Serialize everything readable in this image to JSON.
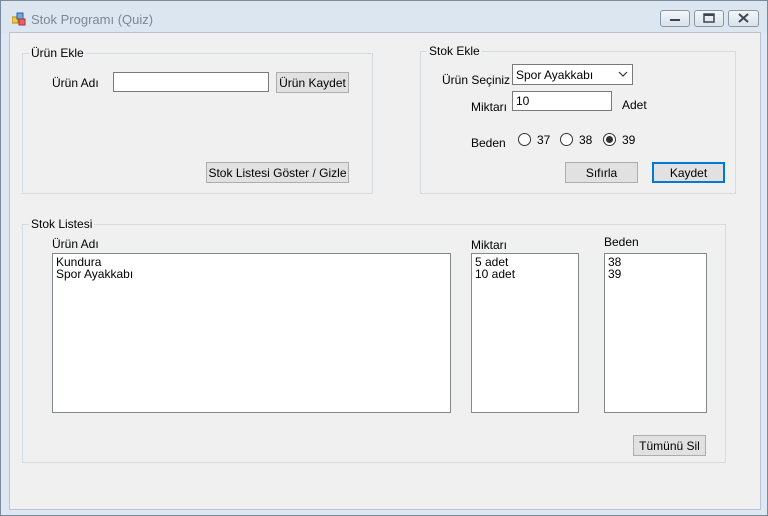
{
  "window": {
    "title": "Stok Programı (Quiz)"
  },
  "urun_ekle": {
    "group_label": "Ürün Ekle",
    "name_label": "Ürün Adı",
    "name_value": "",
    "save_button": "Ürün Kaydet",
    "toggle_button": "Stok Listesi Göster / Gizle"
  },
  "stok_ekle": {
    "group_label": "Stok Ekle",
    "product_label": "Ürün Seçiniz",
    "product_selected": "Spor Ayakkabı",
    "qty_label": "Miktarı",
    "qty_value": "10",
    "qty_unit": "Adet",
    "size_label": "Beden",
    "sizes": [
      {
        "label": "37",
        "checked": false
      },
      {
        "label": "38",
        "checked": false
      },
      {
        "label": "39",
        "checked": true
      }
    ],
    "reset_button": "Sıfırla",
    "save_button": "Kaydet"
  },
  "stok_listesi": {
    "group_label": "Stok Listesi",
    "col_name": "Ürün Adı",
    "col_qty": "Miktarı",
    "col_size": "Beden",
    "names": [
      "Kundura",
      "Spor Ayakkabı"
    ],
    "quantities": [
      "5 adet",
      "10 adet"
    ],
    "sizes": [
      "38",
      "39"
    ],
    "delete_all_button": "Tümünü Sil"
  }
}
